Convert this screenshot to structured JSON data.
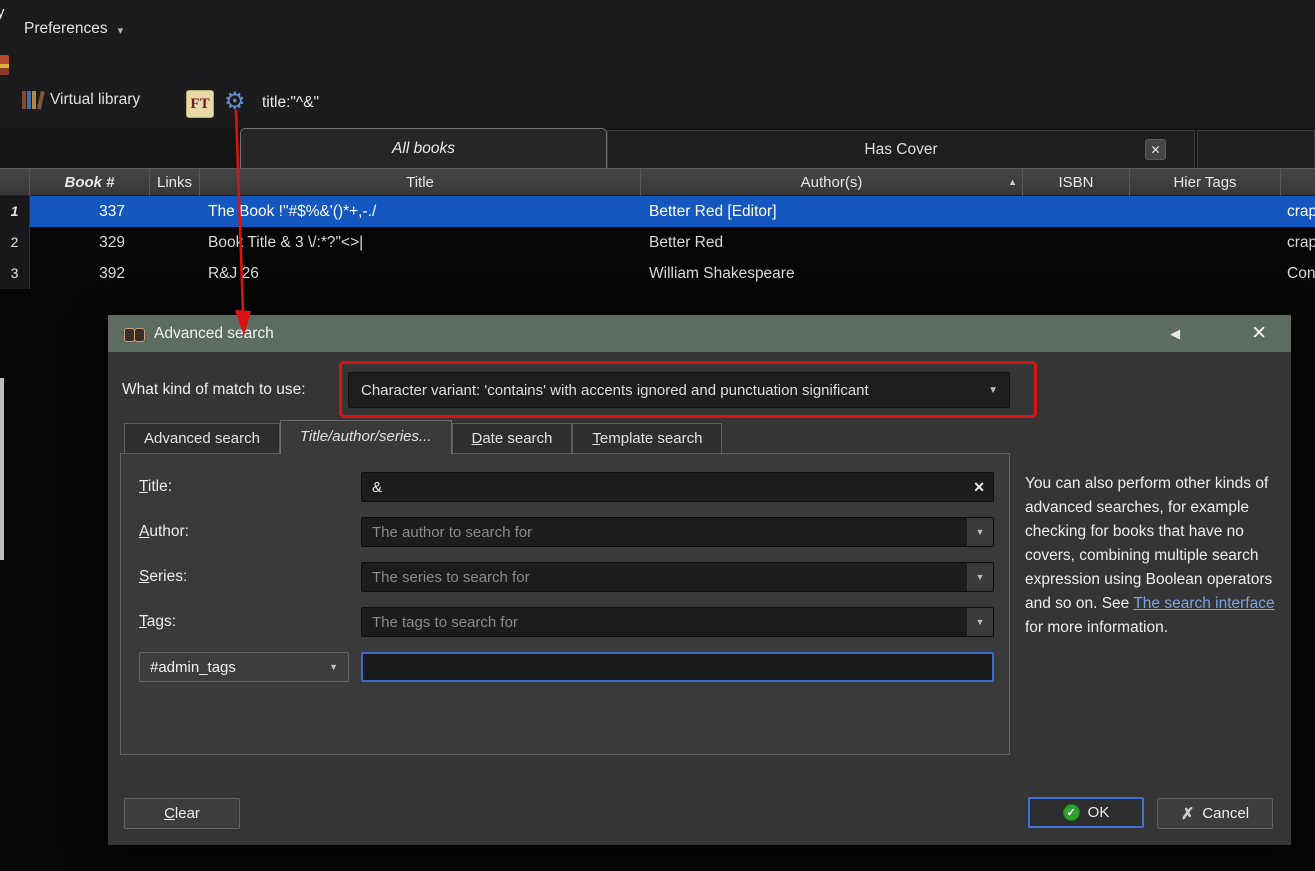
{
  "window": {
    "preferences": "Preferences",
    "edge_letter": "y"
  },
  "toolbar": {
    "virtual_library": "Virtual library",
    "ft_label": "FT",
    "search_query": "title:\"^&\""
  },
  "library_tabs": {
    "all_books": "All books",
    "has_cover": "Has Cover"
  },
  "table": {
    "headers": {
      "book_num": "Book #",
      "links": "Links",
      "title": "Title",
      "authors": "Author(s)",
      "isbn": "ISBN",
      "hier_tags": "Hier Tags"
    },
    "rows": [
      {
        "index": "1",
        "book_num": "337",
        "title": "The Book !\"#$%&'()*+,-./",
        "authors": "Better Red [Editor]",
        "extra": "crap"
      },
      {
        "index": "2",
        "book_num": "329",
        "title": "Book Title & 3 \\/:*?\"<>|",
        "authors": "Better Red",
        "extra": "crap"
      },
      {
        "index": "3",
        "book_num": "392",
        "title": "R&J 26",
        "authors": "William Shakespeare",
        "extra": "Con"
      }
    ]
  },
  "dialog": {
    "title": "Advanced search",
    "match_label": "What kind of match to use:",
    "match_value": "Character variant: 'contains' with accents ignored and punctuation significant",
    "tabs": {
      "advanced": "Advanced search",
      "title_author_series": "Title/author/series...",
      "date_u": "D",
      "date_rest": "ate search",
      "template_u": "T",
      "template_rest": "emplate search"
    },
    "fields": {
      "title_u": "T",
      "title_rest": "itle:",
      "title_value": "&",
      "author_u": "A",
      "author_rest": "uthor:",
      "author_placeholder": "The author to search for",
      "series_u": "S",
      "series_rest": "eries:",
      "series_placeholder": "The series to search for",
      "tags_u": "T",
      "tags_rest": "ags:",
      "tags_placeholder": "The tags to search for",
      "admin_combo_value": "#admin_tags"
    },
    "help": {
      "before": "You can also perform other kinds of advanced searches, for example checking for books that have no covers, combining multiple search expression using Boolean operators and so on. See ",
      "link": "The search interface",
      "after": " for more information."
    },
    "buttons": {
      "clear_u": "C",
      "clear_rest": "lear",
      "ok": "OK",
      "cancel": "Cancel"
    }
  },
  "colors": {
    "selection_blue": "#1457be",
    "annotation_red": "#dc1212",
    "titlebar_green": "#5d6b60",
    "focus_blue": "#3c6ac8",
    "link_blue": "#7ba3e4",
    "ok_green": "#2ea12e"
  },
  "icons": {
    "prefs_caret": "▾",
    "gear": "⚙",
    "combo_arrow": "▼",
    "sort_asc": "▲",
    "close": "✕",
    "clear_field": "✕",
    "collapse_left": "◀",
    "check": "✓",
    "cancel_x": "✗"
  }
}
